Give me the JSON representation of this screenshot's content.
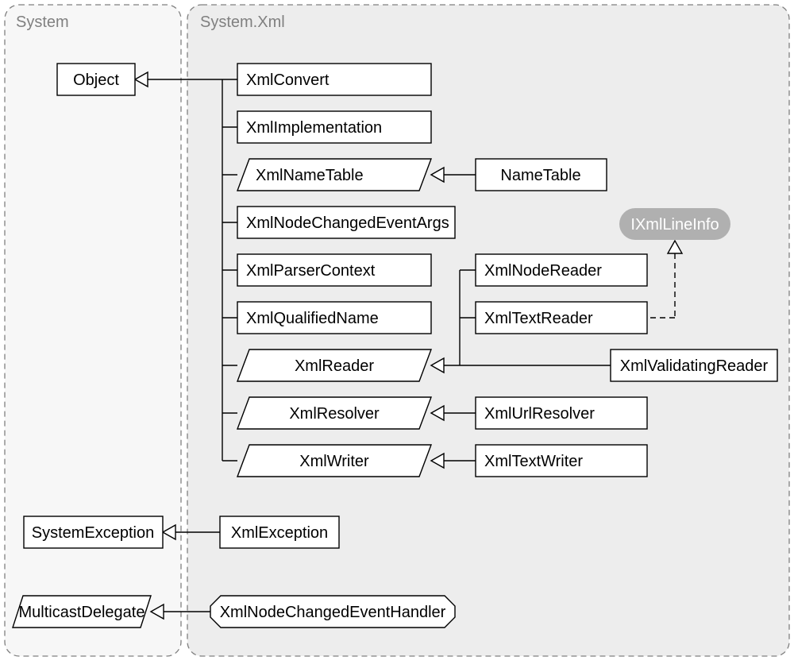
{
  "packages": {
    "system": {
      "label": "System"
    },
    "systemXml": {
      "label": "System.Xml"
    }
  },
  "nodes": {
    "object": {
      "label": "Object"
    },
    "xmlConvert": {
      "label": "XmlConvert"
    },
    "xmlImplementation": {
      "label": "XmlImplementation"
    },
    "xmlNameTable": {
      "label": "XmlNameTable"
    },
    "nameTable": {
      "label": "NameTable"
    },
    "xmlNodeChangedEventArgs": {
      "label": "XmlNodeChangedEventArgs"
    },
    "ixmlLineInfo": {
      "label": "IXmlLineInfo"
    },
    "xmlParserContext": {
      "label": "XmlParserContext"
    },
    "xmlNodeReader": {
      "label": "XmlNodeReader"
    },
    "xmlQualifiedName": {
      "label": "XmlQualifiedName"
    },
    "xmlTextReader": {
      "label": "XmlTextReader"
    },
    "xmlReader": {
      "label": "XmlReader"
    },
    "xmlValidatingReader": {
      "label": "XmlValidatingReader"
    },
    "xmlResolver": {
      "label": "XmlResolver"
    },
    "xmlUrlResolver": {
      "label": "XmlUrlResolver"
    },
    "xmlWriter": {
      "label": "XmlWriter"
    },
    "xmlTextWriter": {
      "label": "XmlTextWriter"
    },
    "systemException": {
      "label": "SystemException"
    },
    "xmlException": {
      "label": "XmlException"
    },
    "multicastDelegate": {
      "label": "MulticastDelegate"
    },
    "xmlNodeChangedEventHandler": {
      "label": "XmlNodeChangedEventHandler"
    }
  }
}
